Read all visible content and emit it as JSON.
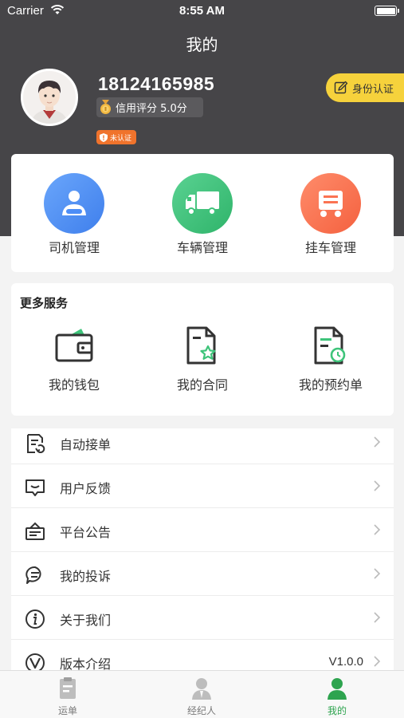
{
  "status_bar": {
    "carrier": "Carrier",
    "time": "8:55 AM"
  },
  "nav": {
    "title": "我的"
  },
  "profile": {
    "phone": "18124165985",
    "credit_label": "信用评分 5.0分",
    "verify_badge": "未认证",
    "id_button": "身份认证"
  },
  "management": [
    {
      "label": "司机管理",
      "icon": "driver-icon",
      "color": "#4d8ef7"
    },
    {
      "label": "车辆管理",
      "icon": "truck-icon",
      "color": "#3ec47a"
    },
    {
      "label": "挂车管理",
      "icon": "trailer-icon",
      "color": "#fb7352"
    }
  ],
  "services": {
    "title": "更多服务",
    "items": [
      {
        "label": "我的钱包",
        "icon": "wallet-icon"
      },
      {
        "label": "我的合同",
        "icon": "contract-icon"
      },
      {
        "label": "我的预约单",
        "icon": "reservation-icon"
      }
    ]
  },
  "menu": [
    {
      "label": "自动接单",
      "icon": "auto-order-icon",
      "value": ""
    },
    {
      "label": "用户反馈",
      "icon": "feedback-icon",
      "value": ""
    },
    {
      "label": "平台公告",
      "icon": "announcement-icon",
      "value": ""
    },
    {
      "label": "我的投诉",
      "icon": "complaint-icon",
      "value": ""
    },
    {
      "label": "关于我们",
      "icon": "info-icon",
      "value": ""
    },
    {
      "label": "版本介绍",
      "icon": "version-icon",
      "value": "V1.0.0"
    }
  ],
  "tabbar": [
    {
      "label": "运单",
      "icon": "waybill-icon",
      "active": false
    },
    {
      "label": "经纪人",
      "icon": "broker-icon",
      "active": false
    },
    {
      "label": "我的",
      "icon": "me-icon",
      "active": true
    }
  ],
  "colors": {
    "header": "#464548",
    "accent_green": "#2ea44f",
    "badge_yellow": "#f6d23c",
    "badge_orange": "#f0732c"
  }
}
